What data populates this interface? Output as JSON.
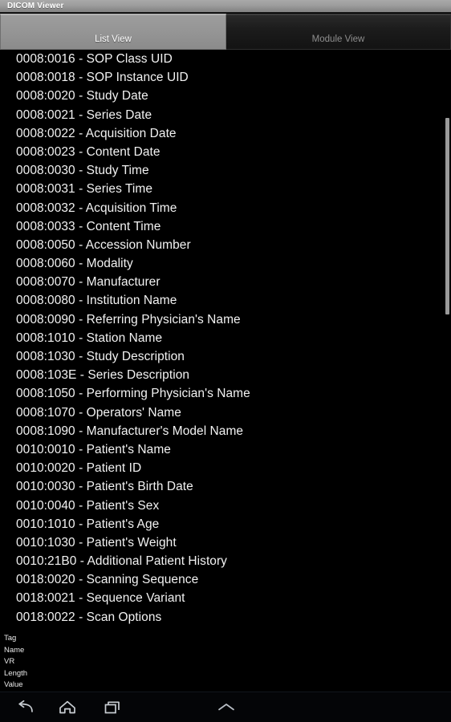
{
  "window": {
    "title": "DICOM Viewer"
  },
  "tabs": [
    {
      "label": "List View",
      "selected": true,
      "name": "tab-list-view"
    },
    {
      "label": "Module View",
      "selected": false,
      "name": "tab-module-view"
    }
  ],
  "list": {
    "items": [
      "0008:0016 - SOP Class UID",
      "0008:0018 - SOP Instance UID",
      "0008:0020 - Study Date",
      "0008:0021 - Series Date",
      "0008:0022 - Acquisition Date",
      "0008:0023 - Content Date",
      "0008:0030 - Study Time",
      "0008:0031 - Series Time",
      "0008:0032 - Acquisition Time",
      "0008:0033 - Content Time",
      "0008:0050 - Accession Number",
      "0008:0060 - Modality",
      "0008:0070 - Manufacturer",
      "0008:0080 - Institution Name",
      "0008:0090 - Referring Physician's Name",
      "0008:1010 - Station Name",
      "0008:1030 - Study Description",
      "0008:103E - Series Description",
      "0008:1050 - Performing Physician's Name",
      "0008:1070 - Operators' Name",
      "0008:1090 - Manufacturer's Model Name",
      "0010:0010 - Patient's Name",
      "0010:0020 - Patient ID",
      "0010:0030 - Patient's Birth Date",
      "0010:0040 - Patient's Sex",
      "0010:1010 - Patient's Age",
      "0010:1030 - Patient's Weight",
      "0010:21B0 - Additional Patient History",
      "0018:0020 - Scanning Sequence",
      "0018:0021 - Sequence Variant",
      "0018:0022 - Scan Options"
    ]
  },
  "detail": {
    "lines": [
      "Tag",
      "Name",
      "VR",
      "Length",
      "Value"
    ]
  },
  "navbar": {
    "buttons": [
      {
        "name": "nav-back-icon",
        "label": "back"
      },
      {
        "name": "nav-home-icon",
        "label": "home"
      },
      {
        "name": "nav-recents-icon",
        "label": "recents"
      },
      {
        "name": "nav-expand-up-icon",
        "label": "expand"
      }
    ]
  },
  "colors": {
    "background": "#000000",
    "titlebar": "#9d9d9d",
    "tab_selected": "#949494",
    "tab_unselected": "#1c1c1c",
    "list_text": "#f2f2f2",
    "scrollbar_thumb": "#9a9a9a"
  }
}
